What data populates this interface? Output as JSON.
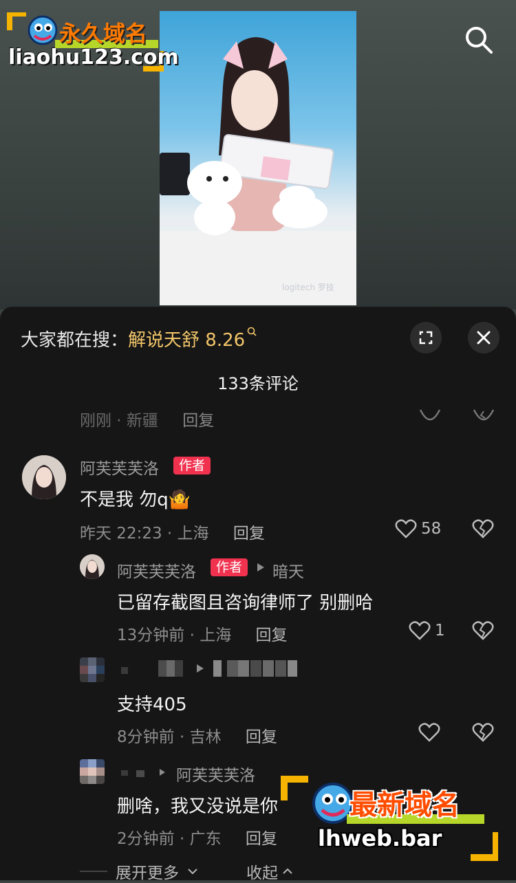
{
  "watermark_top": {
    "title": "永久域名",
    "domain": "liaohu123.com"
  },
  "search": {
    "icon": "search-icon"
  },
  "video": {
    "brand": "logitech 罗技"
  },
  "hot_search": {
    "prefix": "大家都在搜：",
    "keyword": "解说天舒 8.26"
  },
  "comments_count": "133条评论",
  "prev_comment": {
    "meta": "刚刚 · 新疆",
    "reply": "回复"
  },
  "comments": [
    {
      "name": "阿芙芙芙洛",
      "badge": "作者",
      "text": "不是我 勿q🤷",
      "time": "昨天 22:23 · 上海",
      "reply": "回复",
      "likes": "58"
    },
    {
      "name": "阿芙芙芙洛",
      "badge": "作者",
      "reply_to": "暗天",
      "text": "已留存截图且咨询律师了 别删哈",
      "time": "13分钟前 · 上海",
      "reply": "回复",
      "likes": "1"
    },
    {
      "text": "支持405",
      "time": "8分钟前 · 吉林",
      "reply": "回复"
    },
    {
      "reply_to": "阿芙芙芙洛",
      "text": "删啥，我又没说是你",
      "time": "2分钟前 · 广东",
      "reply": "回复"
    }
  ],
  "expand_more": "展开更多",
  "collapse": "收起",
  "watermark_bottom": {
    "title": "最新域名",
    "domain": "lhweb.bar"
  },
  "colors": {
    "sheet_bg": "#161616",
    "badge": "#f0324f",
    "keyword": "#f2c66a"
  }
}
